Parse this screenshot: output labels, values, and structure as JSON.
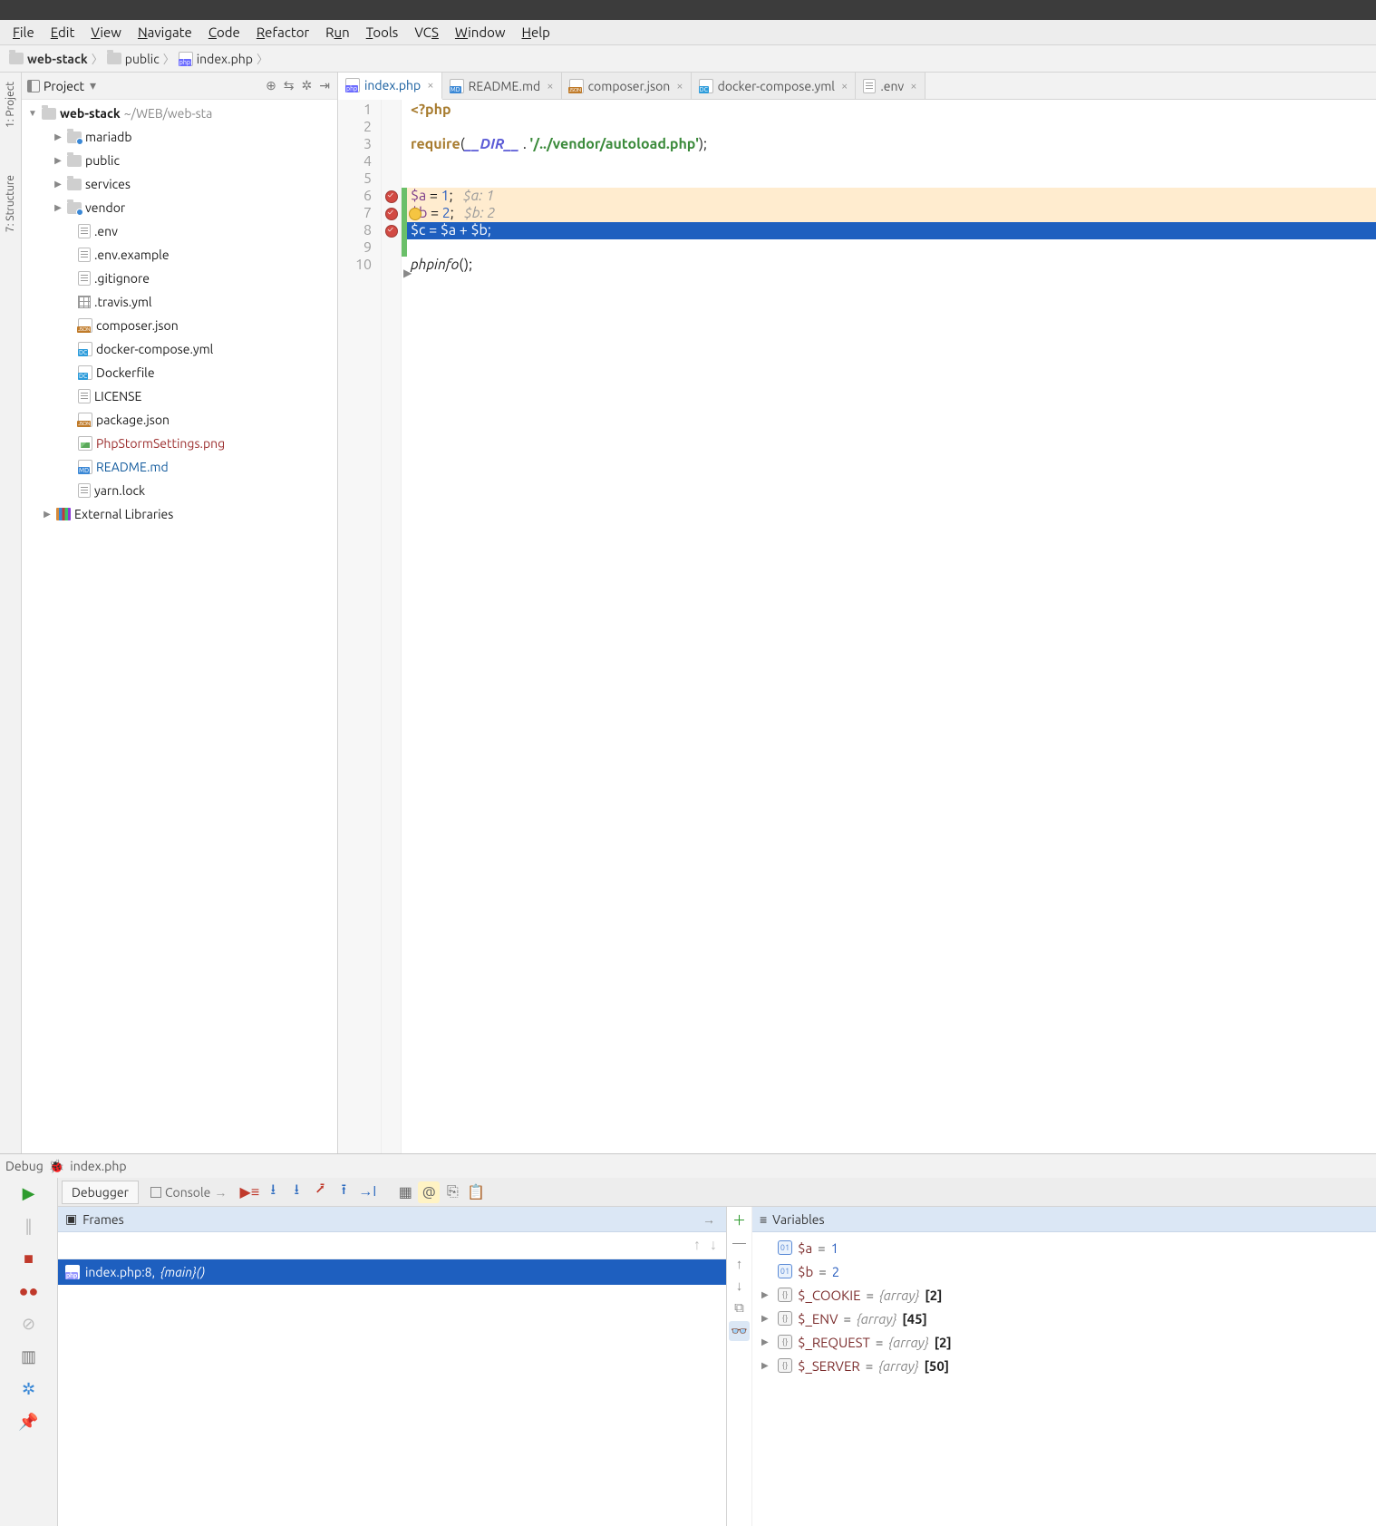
{
  "menu": [
    "File",
    "Edit",
    "View",
    "Navigate",
    "Code",
    "Refactor",
    "Run",
    "Tools",
    "VCS",
    "Window",
    "Help"
  ],
  "breadcrumb": [
    {
      "icon": "folder",
      "label": "web-stack"
    },
    {
      "icon": "folder",
      "label": "public"
    },
    {
      "icon": "php",
      "label": "index.php"
    }
  ],
  "sidetabs": [
    "1: Project",
    "7: Structure"
  ],
  "sidebar": {
    "title": "Project",
    "root": {
      "label": "web-stack",
      "path": "~/WEB/web-sta"
    },
    "folders": [
      "mariadb",
      "public",
      "services",
      "vendor"
    ],
    "files": [
      {
        "icon": "txt",
        "label": ".env"
      },
      {
        "icon": "txt",
        "label": ".env.example"
      },
      {
        "icon": "txt",
        "label": ".gitignore"
      },
      {
        "icon": "grid",
        "label": ".travis.yml"
      },
      {
        "icon": "json",
        "label": "composer.json"
      },
      {
        "icon": "dc",
        "label": "docker-compose.yml"
      },
      {
        "icon": "dc",
        "label": "Dockerfile"
      },
      {
        "icon": "txt",
        "label": "LICENSE"
      },
      {
        "icon": "json",
        "label": "package.json"
      },
      {
        "icon": "img",
        "label": "PhpStormSettings.png",
        "cls": "red"
      },
      {
        "icon": "md",
        "label": "README.md",
        "cls": "blue"
      },
      {
        "icon": "txt",
        "label": "yarn.lock"
      }
    ],
    "external": "External Libraries"
  },
  "tabs": [
    {
      "icon": "php",
      "label": "index.php",
      "active": true
    },
    {
      "icon": "md",
      "label": "README.md"
    },
    {
      "icon": "json",
      "label": "composer.json"
    },
    {
      "icon": "dc",
      "label": "docker-compose.yml"
    },
    {
      "icon": "txt",
      "label": ".env"
    }
  ],
  "code": {
    "lines": [
      "1",
      "2",
      "3",
      "4",
      "5",
      "6",
      "7",
      "8",
      "9",
      "10"
    ],
    "l1": {
      "php": "<?php"
    },
    "l3": {
      "fn": "require",
      "open": "(",
      "dir": "__DIR__",
      "dot": " . ",
      "str": "'/../vendor/autoload.php'",
      "close": ");"
    },
    "l6": {
      "v": "$a",
      "eq": " = ",
      "n": "1",
      "semi": ";",
      "cmt": "$a: 1"
    },
    "l7": {
      "v": "$b",
      "eq": " = ",
      "n": "2",
      "semi": ";",
      "cmt": "$b: 2"
    },
    "l8": {
      "v1": "$c",
      "eq": " = ",
      "v2": "$a",
      "plus": " + ",
      "v3": "$b",
      "semi": ";"
    },
    "l10": {
      "fn": "phpinfo",
      "paren": "();"
    }
  },
  "debug": {
    "title": "Debug",
    "file": "index.php",
    "tabs": {
      "debugger": "Debugger",
      "console": "Console"
    },
    "frames": {
      "title": "Frames",
      "row_file": "index.php:8, ",
      "row_fn": "{main}()"
    },
    "vars": {
      "title": "Variables",
      "scalars": [
        {
          "name": "$a",
          "val": "1"
        },
        {
          "name": "$b",
          "val": "2"
        }
      ],
      "arrays": [
        {
          "name": "$_COOKIE",
          "type": "{array}",
          "count": "[2]"
        },
        {
          "name": "$_ENV",
          "type": "{array}",
          "count": "[45]"
        },
        {
          "name": "$_REQUEST",
          "type": "{array}",
          "count": "[2]"
        },
        {
          "name": "$_SERVER",
          "type": "{array}",
          "count": "[50]"
        }
      ]
    }
  }
}
